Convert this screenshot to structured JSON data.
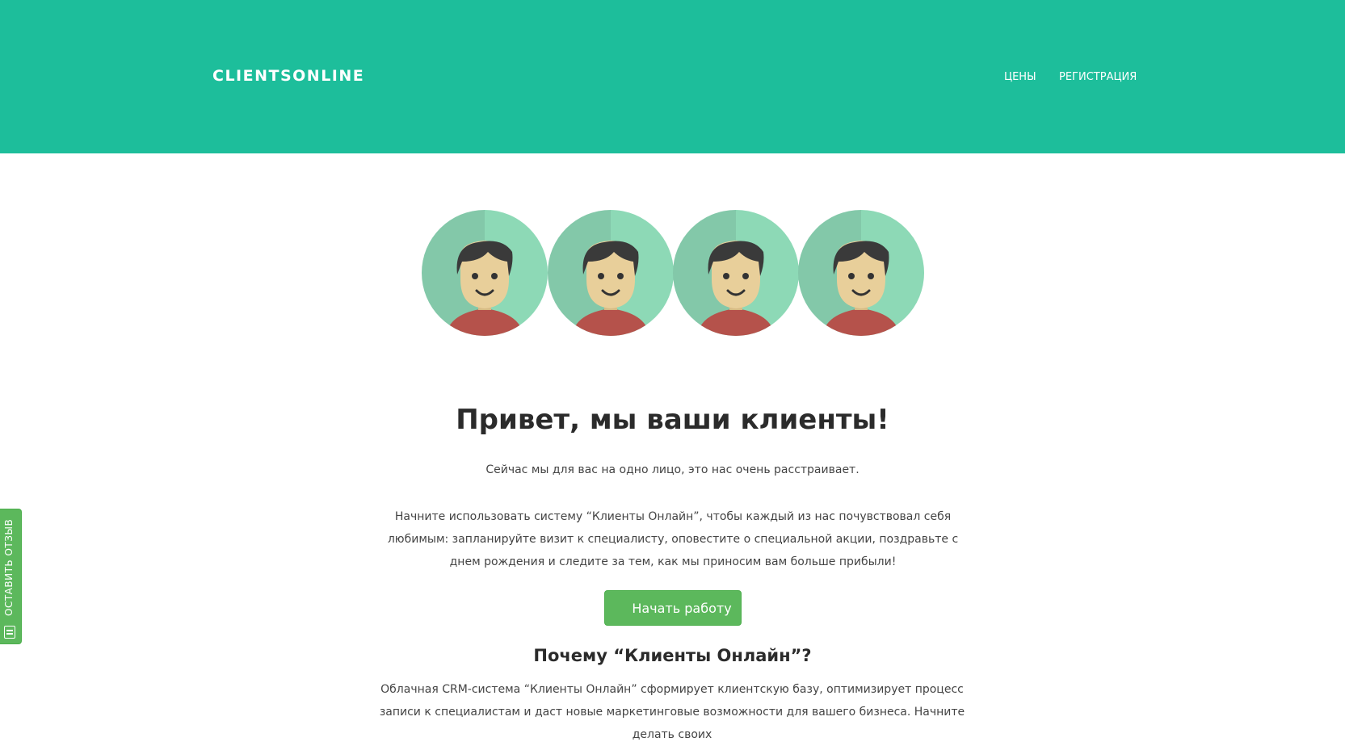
{
  "header": {
    "logo": "CLIENTSONLINE",
    "nav": [
      {
        "label": "ЦЕНЫ"
      },
      {
        "label": "РЕГИСТРАЦИЯ"
      }
    ]
  },
  "hero": {
    "avatar_icon": "client-avatar-icon",
    "title": "Привет, мы ваши клиенты!",
    "subtitle": "Сейчас мы для вас на одно лицо, это нас очень расстраивает.",
    "description": "Начните использовать систему “Клиенты Онлайн”, чтобы каждый из нас почувствовал себя любимым: запланируйте визит к специалисту, оповестите о специальной акции, поздравьте с днем рождения и следите за тем, как мы приносим вам больше прибыли!",
    "cta_label": "Начать работу"
  },
  "why": {
    "title": "Почему “Клиенты Онлайн”?",
    "text": "Облачная CRM-система “Клиенты Онлайн” сформирует клиентскую базу, оптимизирует процесс записи к специалистам и даст новые маркетинговые возможности для вашего бизнеса. Начните делать своих"
  },
  "feedback": {
    "label": "ОСТАВИТЬ ОТЗЫВ",
    "icon": "feedback-form-icon"
  },
  "colors": {
    "header_bg": "#1dbe9b",
    "button_green": "#5cb85c",
    "avatar_bg_dark": "#83c8a9",
    "avatar_bg_light": "#8dd9b6",
    "hair": "#3a3a3a",
    "skin": "#e8cf9a",
    "shirt": "#b5524b"
  }
}
